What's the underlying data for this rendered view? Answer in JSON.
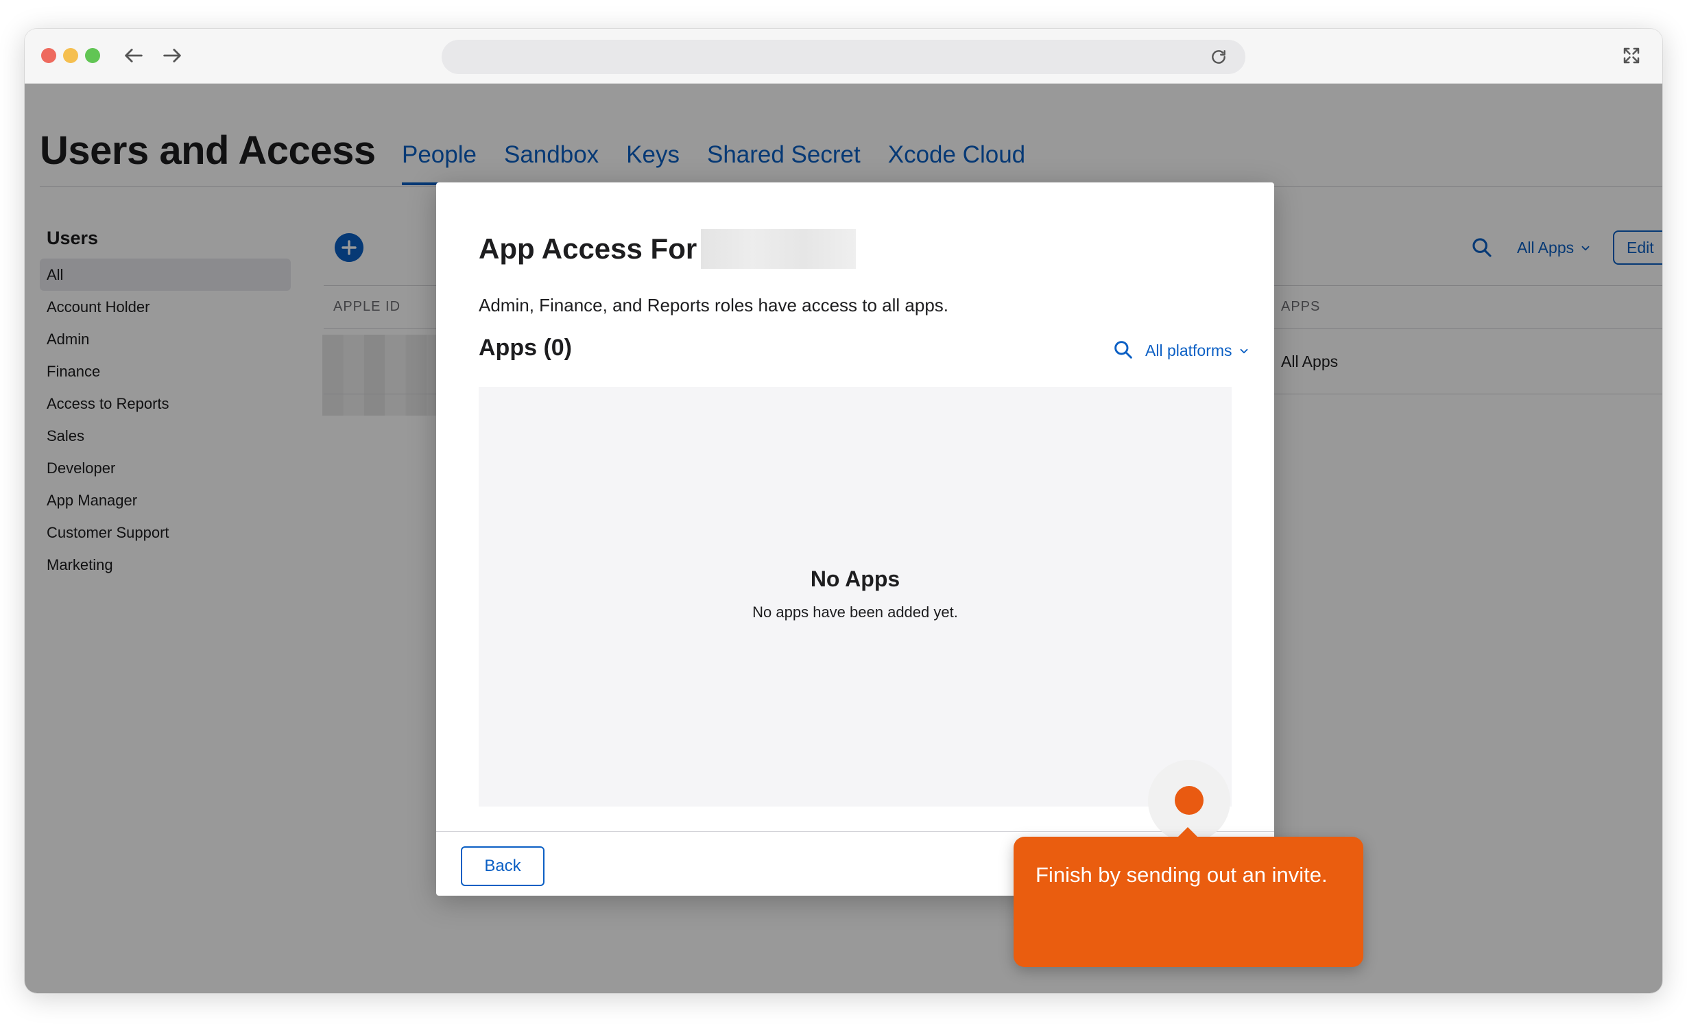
{
  "browser": {
    "url": ""
  },
  "page": {
    "title": "Users and Access",
    "tabs": [
      {
        "label": "People",
        "active": true
      },
      {
        "label": "Sandbox",
        "active": false
      },
      {
        "label": "Keys",
        "active": false
      },
      {
        "label": "Shared Secret",
        "active": false
      },
      {
        "label": "Xcode Cloud",
        "active": false
      }
    ]
  },
  "sidebar": {
    "heading": "Users",
    "items": [
      {
        "label": "All",
        "active": true
      },
      {
        "label": "Account Holder"
      },
      {
        "label": "Admin"
      },
      {
        "label": "Finance"
      },
      {
        "label": "Access to Reports"
      },
      {
        "label": "Sales"
      },
      {
        "label": "Developer"
      },
      {
        "label": "App Manager"
      },
      {
        "label": "Customer Support"
      },
      {
        "label": "Marketing"
      }
    ]
  },
  "table": {
    "columns": {
      "apple_id": "APPLE ID",
      "apps": "APPS"
    },
    "rows": [
      {
        "apps": "All Apps"
      }
    ]
  },
  "toolbar": {
    "filter_label": "All Apps",
    "edit_label": "Edit"
  },
  "modal": {
    "title": "App Access For",
    "description": "Admin, Finance, and Reports roles have access to all apps.",
    "apps_heading": "Apps (0)",
    "platform_filter": "All platforms",
    "empty_title": "No Apps",
    "empty_subtitle": "No apps have been added yet.",
    "back_label": "Back"
  },
  "guide": {
    "tooltip": "Finish by sending out an invite.",
    "accent_color": "#EA5D0F"
  },
  "colors": {
    "link_blue": "#0B5FC4"
  }
}
